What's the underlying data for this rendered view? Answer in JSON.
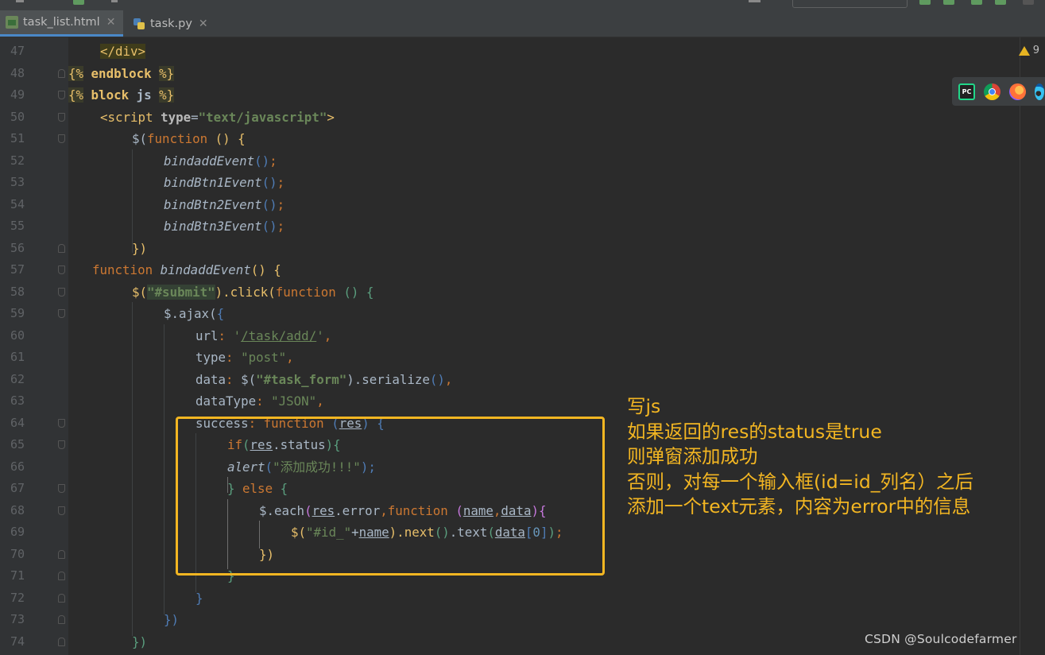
{
  "tabs": [
    {
      "label": "task_list.html",
      "icon": "html-file-icon",
      "active": true
    },
    {
      "label": "task.py",
      "icon": "python-file-icon",
      "active": false
    }
  ],
  "warnings": {
    "count": "9"
  },
  "browsers": [
    "pycharm-icon",
    "chrome-icon",
    "firefox-icon",
    "edge-icon"
  ],
  "line_numbers": [
    "47",
    "48",
    "49",
    "50",
    "51",
    "52",
    "53",
    "54",
    "55",
    "56",
    "57",
    "58",
    "59",
    "60",
    "61",
    "62",
    "63",
    "64",
    "65",
    "66",
    "67",
    "68",
    "69",
    "70",
    "71",
    "72",
    "73",
    "74"
  ],
  "code": {
    "l47": "</div>",
    "l48_open": "{%",
    "l48_kw": "endblock",
    "l48_close": "%}",
    "l49_open": "{%",
    "l49_kw": "block",
    "l49_name": "js",
    "l49_close": "%}",
    "l50_tag_open": "<script",
    "l50_attr": "type",
    "l50_eq": "=",
    "l50_val": "\"text/javascript\"",
    "l50_tag_close": ">",
    "l51_dollar": "$(",
    "l51_fn": "function",
    "l51_rest": " () {",
    "l52": "bindaddEvent",
    "l53": "bindBtn1Event",
    "l54": "bindBtn2Event",
    "l55": "bindBtn3Event",
    "call_parens": "()",
    "semi": ";",
    "l56": "})",
    "l57_kw": "function",
    "l57_name": "bindaddEvent",
    "l57_rest": "() {",
    "l58_a": "$(",
    "l58_sel": "\"#submit\"",
    "l58_b": ").click(",
    "l58_fn": "function",
    "l58_c": " () {",
    "l59_a": "$.ajax(",
    "l59_b": "{",
    "l60_key": "url",
    "l60_colon": ": ",
    "l60_q1": "'",
    "l60_val": "/task/add/",
    "l60_q2": "'",
    "comma": ",",
    "l61_key": "type",
    "l61_val": "\"post\"",
    "l62_key": "data",
    "l62_a": "$(",
    "l62_sel": "\"#task_form\"",
    "l62_b": ").serialize",
    "l62_c": "()",
    "l63_key": "dataType",
    "l63_val": "\"JSON\"",
    "l64_key": "success",
    "l64_fn": "function",
    "l64_a": " (",
    "l64_p": "res",
    "l64_b": ") {",
    "l65_kw": "if",
    "l65_a": "(",
    "l65_p": "res",
    "l65_b": ".status",
    "l65_c": "){",
    "l66_fn": "alert",
    "l66_a": "(",
    "l66_str": "\"添加成功!!!\"",
    "l66_b": ");",
    "l67_a": "} ",
    "l67_kw": "else",
    "l67_b": " {",
    "l68_a": "$.each",
    "l68_b": "(",
    "l68_p1": "res",
    "l68_c": ".error",
    "l68_d": ",",
    "l68_fn": "function",
    "l68_e": " (",
    "l68_p2": "name",
    "l68_f": ",",
    "l68_p3": "data",
    "l68_g": "){",
    "l69_a": "$(",
    "l69_str": "\"#id_\"",
    "l69_plus": "+",
    "l69_p": "name",
    "l69_b": ").next",
    "l69_c": "()",
    "l69_d": ".text",
    "l69_e": "(",
    "l69_p2": "data",
    "l69_f": "[",
    "l69_num": "0",
    "l69_g": "]",
    "l69_h": ")",
    "l69_semi": ";",
    "l70": "})",
    "l71": "}",
    "l72": "}",
    "l73": "})",
    "l74": "})"
  },
  "annotation": {
    "title": "写js",
    "lines": [
      "如果返回的res的status是true",
      "则弹窗添加成功",
      "否则，对每一个输入框(id=id_列名）之后",
      "添加一个text元素，内容为error中的信息"
    ],
    "color": "#f3b622"
  },
  "watermark": "CSDN @Soulcodefarmer"
}
